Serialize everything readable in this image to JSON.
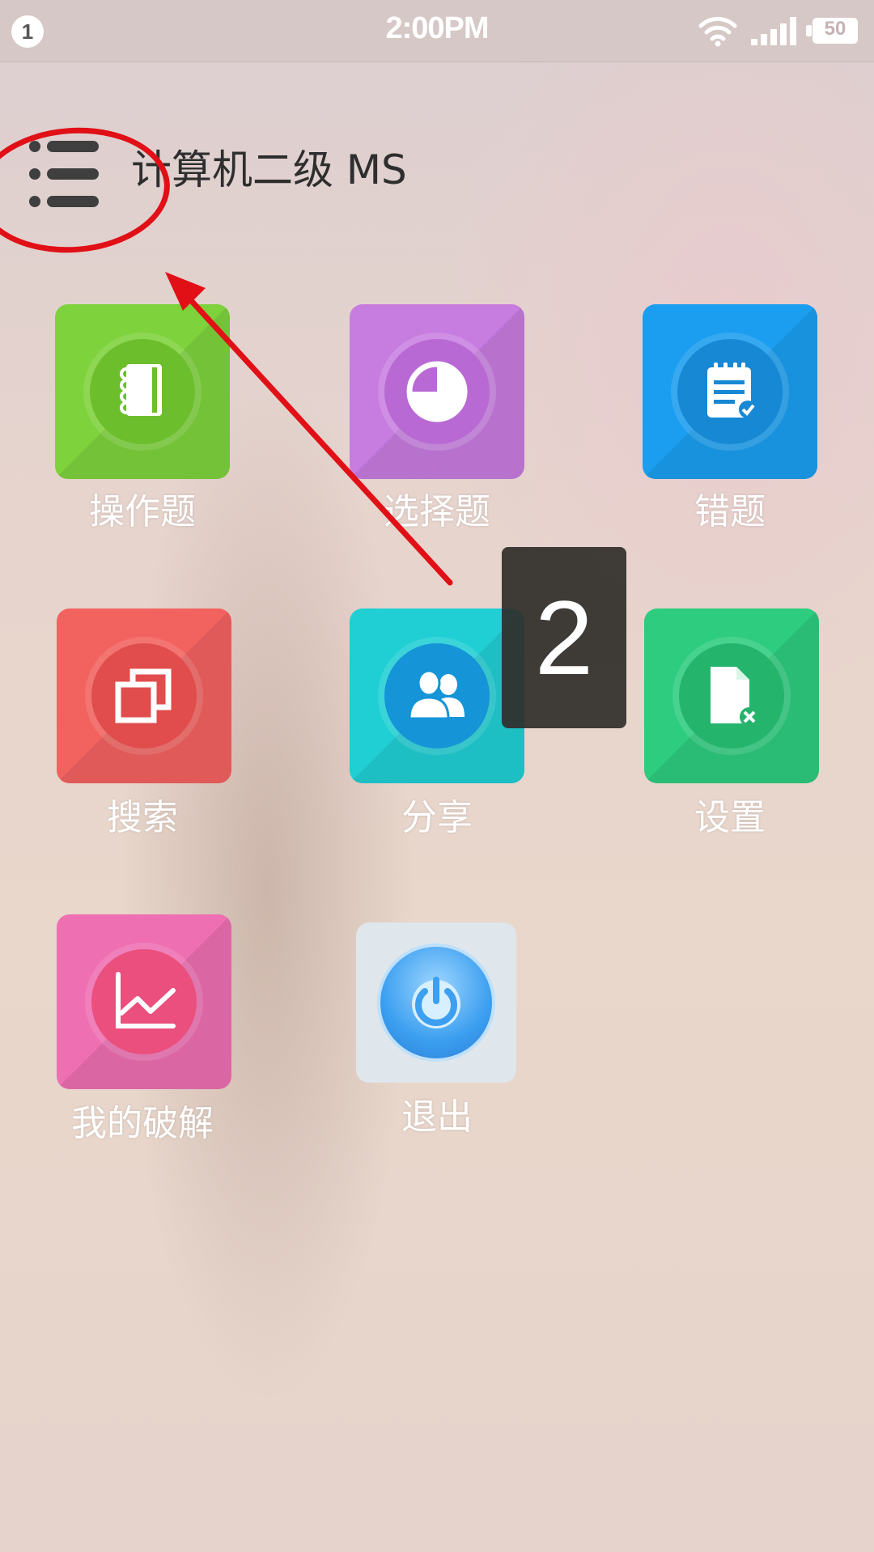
{
  "status_bar": {
    "notification_count": "1",
    "time": "2:00PM",
    "battery": "50"
  },
  "header": {
    "title": "计算机二级 MS",
    "menu_icon": "hamburger-menu-icon"
  },
  "grid": {
    "items": [
      {
        "label": "操作题",
        "icon": "notebook-icon",
        "color": "#7ed23c"
      },
      {
        "label": "选择题",
        "icon": "pie-chart-icon",
        "color": "#c77ce0"
      },
      {
        "label": "错题",
        "icon": "notepad-check-icon",
        "color": "#1b9ef0"
      },
      {
        "label": "搜索",
        "icon": "copy-windows-icon",
        "color": "#f2625f"
      },
      {
        "label": "分享",
        "icon": "users-icon",
        "color": "#1fcfd4"
      },
      {
        "label": "设置",
        "icon": "file-delete-icon",
        "color": "#2ecc7f"
      },
      {
        "label": "我的破解",
        "icon": "line-chart-icon",
        "color": "#ee6fb2"
      },
      {
        "label": "退出",
        "icon": "power-icon",
        "color": "#3c9ff0"
      }
    ]
  },
  "annotations": {
    "step_number": "2",
    "accent_color": "#e10f16"
  }
}
